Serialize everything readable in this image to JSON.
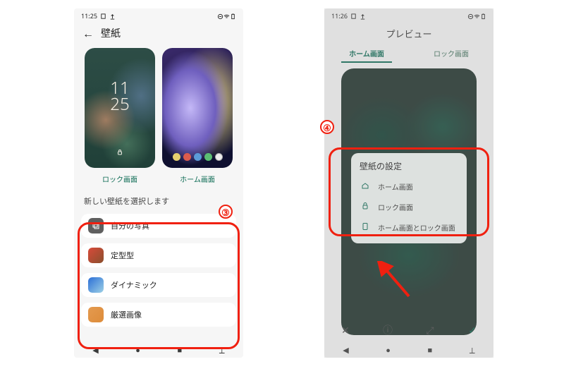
{
  "annotation": {
    "badge3": "③",
    "badge4": "④"
  },
  "phone1": {
    "status": {
      "time": "11:25"
    },
    "title": "壁紙",
    "lockscreen": {
      "clockTop": "11",
      "clockBottom": "25",
      "caption": "ロック画面"
    },
    "homescreen": {
      "caption": "ホーム画面"
    },
    "sectionTitle": "新しい壁紙を選択します",
    "list": [
      {
        "label": "自分の写真"
      },
      {
        "label": "定型型"
      },
      {
        "label": "ダイナミック"
      },
      {
        "label": "厳選画像"
      }
    ]
  },
  "phone2": {
    "status": {
      "time": "11:26"
    },
    "title": "プレビュー",
    "tabs": {
      "home": "ホーム画面",
      "lock": "ロック画面"
    },
    "applySheet": {
      "title": "壁紙の設定",
      "options": [
        {
          "label": "ホーム画面"
        },
        {
          "label": "ロック画面"
        },
        {
          "label": "ホーム画面とロック画面"
        }
      ]
    }
  }
}
